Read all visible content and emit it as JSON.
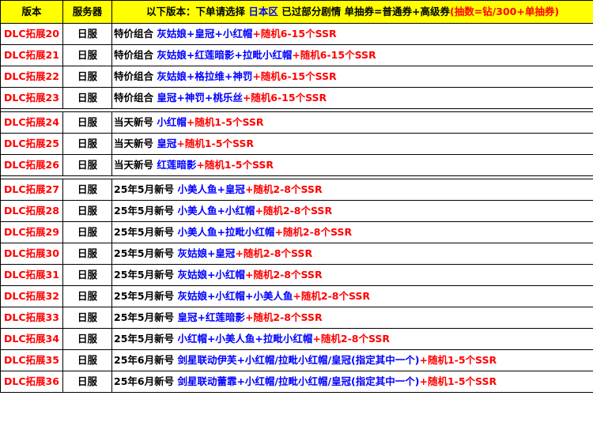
{
  "header": {
    "col_version": "版本",
    "col_server": "服务器",
    "info_prefix": "以下版本：下单请选择",
    "info_region": "日本区",
    "info_middle": "已过部分剧情 单抽券=普通券+高级券",
    "info_formula": "(抽数=钻/300+单抽券)"
  },
  "groups": [
    {
      "rows": [
        {
          "version": "DLC拓展20",
          "server": "日服",
          "prefix": "特价组合",
          "items": "灰姑娘+皇冠+小红帽",
          "random": "+随机6-15个SSR"
        },
        {
          "version": "DLC拓展21",
          "server": "日服",
          "prefix": "特价组合",
          "items": "灰姑娘+红莲暗影+拉毗小红帽",
          "random": "+随机6-15个SSR"
        },
        {
          "version": "DLC拓展22",
          "server": "日服",
          "prefix": "特价组合",
          "items": "灰姑娘+格拉维+神罚",
          "random": "+随机6-15个SSR"
        },
        {
          "version": "DLC拓展23",
          "server": "日服",
          "prefix": "特价组合",
          "items": "皇冠+神罚+桃乐丝",
          "random": "+随机6-15个SSR"
        }
      ]
    },
    {
      "rows": [
        {
          "version": "DLC拓展24",
          "server": "日服",
          "prefix": "当天新号",
          "items": "小红帽",
          "random": "+随机1-5个SSR"
        },
        {
          "version": "DLC拓展25",
          "server": "日服",
          "prefix": "当天新号",
          "items": "皇冠",
          "random": "+随机1-5个SSR"
        },
        {
          "version": "DLC拓展26",
          "server": "日服",
          "prefix": "当天新号",
          "items": "红莲暗影",
          "random": "+随机1-5个SSR"
        }
      ]
    },
    {
      "rows": [
        {
          "version": "DLC拓展27",
          "server": "日服",
          "prefix": "25年5月新号",
          "items": "小美人鱼+皇冠",
          "random": "+随机2-8个SSR"
        },
        {
          "version": "DLC拓展28",
          "server": "日服",
          "prefix": "25年5月新号",
          "items": "小美人鱼+小红帽",
          "random": "+随机2-8个SSR"
        },
        {
          "version": "DLC拓展29",
          "server": "日服",
          "prefix": "25年5月新号",
          "items": "小美人鱼+拉毗小红帽",
          "random": "+随机2-8个SSR"
        },
        {
          "version": "DLC拓展30",
          "server": "日服",
          "prefix": "25年5月新号",
          "items": "灰姑娘+皇冠",
          "random": "+随机2-8个SSR"
        },
        {
          "version": "DLC拓展31",
          "server": "日服",
          "prefix": "25年5月新号",
          "items": "灰姑娘+小红帽",
          "random": "+随机2-8个SSR"
        },
        {
          "version": "DLC拓展32",
          "server": "日服",
          "prefix": "25年5月新号",
          "items": "灰姑娘+小红帽+小美人鱼",
          "random": "+随机2-8个SSR"
        },
        {
          "version": "DLC拓展33",
          "server": "日服",
          "prefix": "25年5月新号",
          "items": "皇冠+红莲暗影",
          "random": "+随机2-8个SSR"
        },
        {
          "version": "DLC拓展34",
          "server": "日服",
          "prefix": "25年5月新号",
          "items": "小红帽+小美人鱼+拉毗小红帽",
          "random": "+随机2-8个SSR"
        },
        {
          "version": "DLC拓展35",
          "server": "日服",
          "prefix": "25年6月新号",
          "items": "剑星联动伊芙+小红帽/拉毗小红帽/皇冠(指定其中一个)",
          "random": "+随机1-5个SSR"
        },
        {
          "version": "DLC拓展36",
          "server": "日服",
          "prefix": "25年6月新号",
          "items": "剑星联动蕾霏+小红帽/拉毗小红帽/皇冠(指定其中一个)",
          "random": "+随机1-5个SSR"
        }
      ]
    }
  ]
}
